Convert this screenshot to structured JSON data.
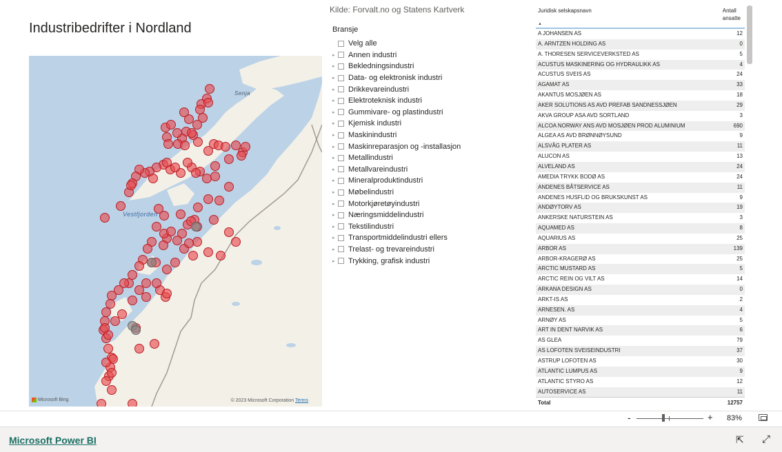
{
  "report": {
    "title": "Industribedrifter i Nordland",
    "source": "Kilde: Forvalt.no og Statens Kartverk"
  },
  "map": {
    "labels": {
      "senja": "Senja",
      "vestfjorden": "Vestfjorden"
    },
    "attribution": "Microsoft Bing",
    "copyright": "© 2023 Microsoft Corporation",
    "terms": "Terms",
    "point_color": "#e8484d"
  },
  "slicer": {
    "header": "Bransje",
    "items": [
      "Velg alle",
      "Annen industri",
      "Bekledningsindustri",
      "Data- og elektronisk industri",
      "Drikkevareindustri",
      "Elektroteknisk industri",
      "Gummivare- og plastindustri",
      "Kjemisk industri",
      "Maskinindustri",
      "Maskinreparasjon og -installasjon",
      "Metallindustri",
      "Metallvareindustri",
      "Mineralproduktindustri",
      "Møbelindustri",
      "Motorkjøretøyindustri",
      "Næringsmiddelindustri",
      "Tekstilindustri",
      "Transportmiddelindustri ellers",
      "Trelast- og trevareindustri",
      "Trykking, grafisk industri"
    ]
  },
  "table": {
    "col1": "Juridisk selskapsnavn",
    "col2_line1": "Antall",
    "col2_line2": "ansatte",
    "sort_glyph": "▲",
    "rows": [
      [
        "A JOHANSEN AS",
        "12"
      ],
      [
        "A. ARNTZEN HOLDING AS",
        "0"
      ],
      [
        "A. THORESEN SERVICEVERKSTED AS",
        "5"
      ],
      [
        "ACUSTUS MASKINERING OG HYDRAULIKK AS",
        "4"
      ],
      [
        "ACUSTUS SVEIS AS",
        "24"
      ],
      [
        "AGAMAT AS",
        "33"
      ],
      [
        "AKANTUS MOSJØEN AS",
        "18"
      ],
      [
        "AKER SOLUTIONS AS AVD PREFAB SANDNESSJØEN",
        "29"
      ],
      [
        "AKVA GROUP ASA AVD SORTLAND",
        "3"
      ],
      [
        "ALCOA NORWAY ANS AVD MOSJØEN PROD ALUMINIUM",
        "690"
      ],
      [
        "ALGEA AS AVD BRØNNØYSUND",
        "9"
      ],
      [
        "ALSVÅG PLATER AS",
        "11"
      ],
      [
        "ALUCON AS",
        "13"
      ],
      [
        "ALVELAND AS",
        "24"
      ],
      [
        "AMEDIA TRYKK BODØ AS",
        "24"
      ],
      [
        "ANDENES BÅTSERVICE AS",
        "11"
      ],
      [
        "ANDENES HUSFLID OG BRUKSKUNST AS",
        "9"
      ],
      [
        "ANDØYTORV AS",
        "19"
      ],
      [
        "ANKERSKE NATURSTEIN AS",
        "3"
      ],
      [
        "AQUAMED AS",
        "8"
      ],
      [
        "AQUARIUS AS",
        "25"
      ],
      [
        "ARBOR AS",
        "139"
      ],
      [
        "ARBOR-KRAGERØ AS",
        "25"
      ],
      [
        "ARCTIC MUSTARD AS",
        "5"
      ],
      [
        "ARCTIC REIN OG VILT AS",
        "14"
      ],
      [
        "ARKANA DESIGN AS",
        "0"
      ],
      [
        "ARKT-IS AS",
        "2"
      ],
      [
        "ARNESEN. AS",
        "4"
      ],
      [
        "ARNØY AS",
        "5"
      ],
      [
        "ART IN DENT NARVIK AS",
        "6"
      ],
      [
        "AS GLEA",
        "79"
      ],
      [
        "AS LOFOTEN SVEISEINDUSTRI",
        "37"
      ],
      [
        "ASTRUP LOFOTEN AS",
        "30"
      ],
      [
        "ATLANTIC LUMPUS AS",
        "9"
      ],
      [
        "ATLANTIC STYRO AS",
        "12"
      ],
      [
        "AUTOSERVICE AS",
        "11"
      ]
    ],
    "total_label": "Total",
    "total_value": "12757"
  },
  "zoom": {
    "minus": "-",
    "plus": "+",
    "percent": "83%"
  },
  "footer": {
    "brand": "Microsoft Power BI",
    "share_icon": "⇱",
    "expand_icon": "⤢"
  }
}
